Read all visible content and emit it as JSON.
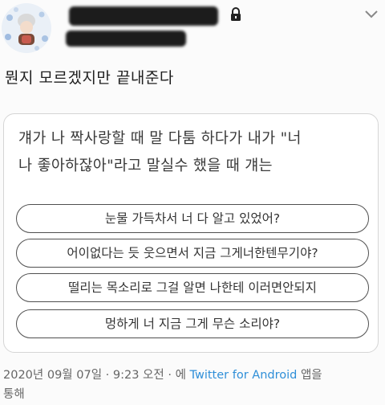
{
  "tweet": {
    "text": "뭔지 모르겠지만 끝내준다",
    "lock_icon": "lock-icon",
    "menu_icon": "chevron-down-icon"
  },
  "poll": {
    "question_line1": "걔가 나 짝사랑할 때 말 다툼 하다가 내가 \"너",
    "question_line2": "나 좋아하잖아\"라고 말실수 했을 때 걔는",
    "options": [
      "눈물 가득차서 너 다 알고 있었어?",
      "어이없다는 듯 웃으면서 지금 그게너한텐무기야?",
      "떨리는 목소리로 그걸 알면 나한테 이러면안되지",
      "멍하게 너 지금 그게 무슨 소리야?"
    ]
  },
  "meta": {
    "date": "2020년 09월 07일",
    "sep1": "·",
    "time": "9:23 오전",
    "sep2": "·",
    "via_prefix": "에",
    "app": "Twitter for Android",
    "suffix1": "앱을",
    "suffix2": "통해"
  },
  "colors": {
    "link": "#2f8fd8",
    "redaction": "#1c1c1c"
  }
}
